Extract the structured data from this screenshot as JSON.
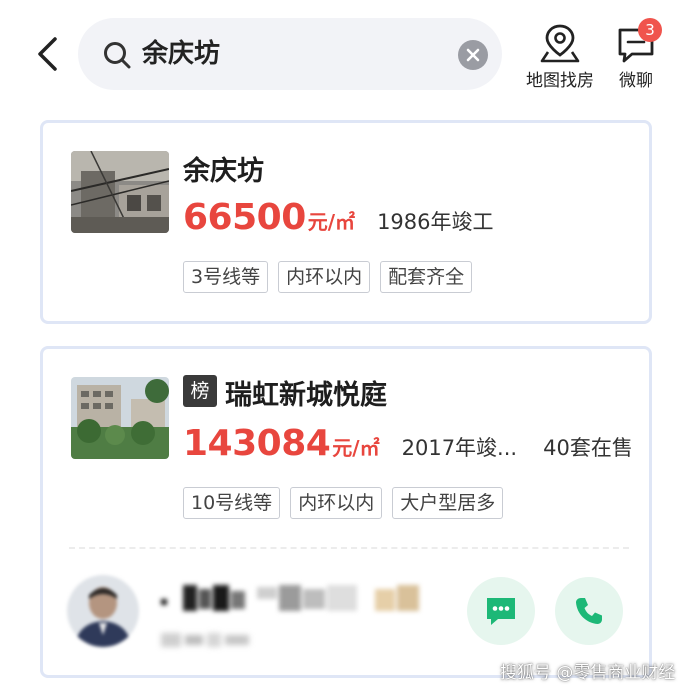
{
  "search": {
    "query": "余庆坊"
  },
  "header": {
    "map_label": "地图找房",
    "chat_label": "微聊",
    "chat_badge": "3"
  },
  "listings": [
    {
      "title": "余庆坊",
      "price": "66500",
      "unit": "元/㎡",
      "year": "1986年竣工",
      "tags": [
        "3号线等",
        "内环以内",
        "配套齐全"
      ]
    },
    {
      "rank_badge": "榜",
      "title": "瑞虹新城悦庭",
      "price": "143084",
      "unit": "元/㎡",
      "year": "2017年竣...",
      "on_sale": "40套在售",
      "tags": [
        "10号线等",
        "内环以内",
        "大户型居多"
      ]
    }
  ],
  "watermark": "搜狐号 @零售商业财经",
  "colors": {
    "price_red": "#e8463e",
    "card_border": "#dfe6f6",
    "action_green": "#1db877",
    "action_bg": "#e6f6ee"
  }
}
